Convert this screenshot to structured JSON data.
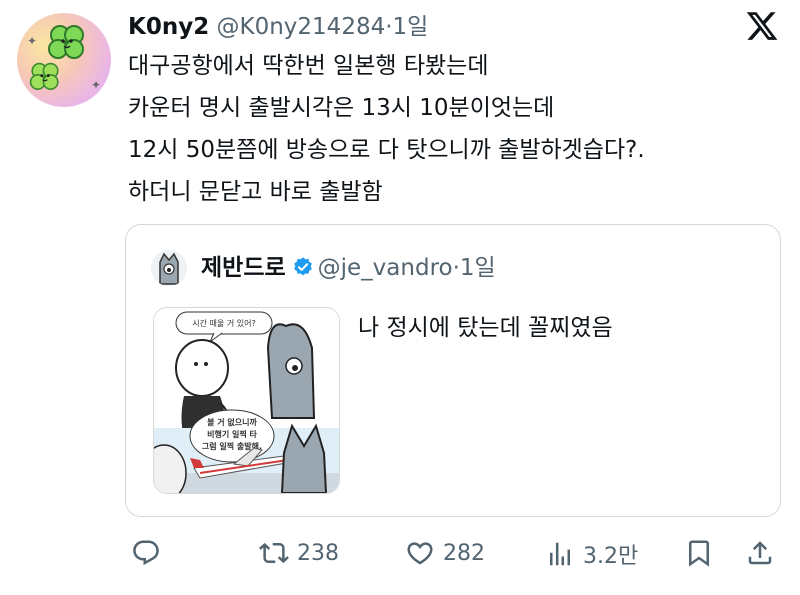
{
  "author": {
    "display_name": "K0ny2",
    "handle": "@K0ny214284",
    "separator": "·",
    "time": "1일"
  },
  "tweet": {
    "lines": [
      "대구공항에서 딱한번 일본행 타봤는데",
      "카운터 명시 출발시각은 13시 10분이엇는데",
      "12시 50분쯤에 방송으로 다 탓으니까 출발하겟습다?.",
      "하더니 문닫고 바로 출발함"
    ]
  },
  "quote": {
    "display_name": "제반드로",
    "handle": "@je_vandro",
    "separator": "·",
    "time": "1일",
    "text": "나 정시에 탔는데 꼴찌였음",
    "image": {
      "bubble_top": "시간 때울 거 있어?",
      "bubble_bottom": [
        "볼 거 없으니까",
        "비행기 일찍 타",
        "그럼 일찍 출발해."
      ]
    }
  },
  "actions": {
    "reply": {
      "icon": "reply-icon"
    },
    "retweet": {
      "icon": "retweet-icon",
      "count": "238"
    },
    "like": {
      "icon": "heart-icon",
      "count": "282"
    },
    "views": {
      "icon": "views-icon",
      "count": "3.2만"
    },
    "bookmark": {
      "icon": "bookmark-icon"
    },
    "share": {
      "icon": "share-icon"
    }
  },
  "colors": {
    "text": "#0f1419",
    "secondary": "#536471",
    "border": "#cfd9de",
    "verified": "#1d9bf0"
  }
}
